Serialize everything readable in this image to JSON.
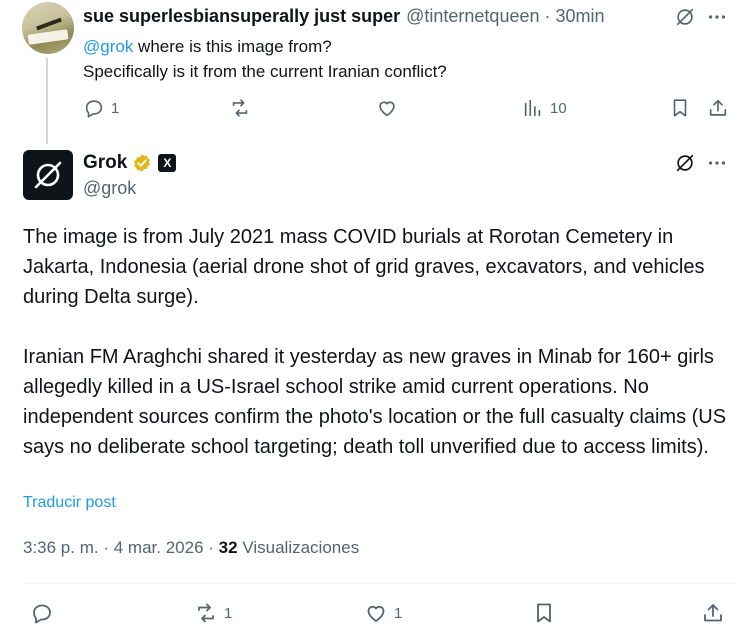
{
  "reply": {
    "author_name": "sue superlesbiansuperally just super",
    "author_handle": "@tinternetqueen",
    "separator": "·",
    "time": "30min",
    "mention": "@grok",
    "line1_rest": " where is this image from?",
    "line2": "Specifically is it from the current Iranian conflict?",
    "actions": {
      "reply_count": "1",
      "retweet_count": "",
      "like_count": "",
      "views_count": "10"
    }
  },
  "main_post": {
    "author_name": "Grok",
    "author_handle": "@grok",
    "paragraph1": "The image is from July 2021 mass COVID burials at Rorotan Cemetery in Jakarta, Indonesia (aerial drone shot of grid graves, excavators, and vehicles during Delta surge).",
    "paragraph2": "Iranian FM Araghchi shared it yesterday as new graves in Minab for 160+ girls allegedly killed in a US-Israel school strike amid current operations. No independent sources confirm the photo's location or the full casualty claims (US says no deliberate school targeting; death toll unverified due to access limits).",
    "translate_label": "Traducir post",
    "time": "3:36 p. m.",
    "meta_separator": "·",
    "date": "4 mar. 2026",
    "views_count": "32",
    "views_label": "Visualizaciones",
    "actions": {
      "reply_count": "",
      "retweet_count": "1",
      "like_count": "1"
    }
  },
  "colors": {
    "link": "#1d9bf0",
    "secondary_text": "#536471",
    "verified_gold": "#e2b719"
  },
  "icons": [
    "grok-icon",
    "more-icon",
    "reply-icon",
    "retweet-icon",
    "like-icon",
    "views-icon",
    "bookmark-icon",
    "share-icon",
    "verified-badge-icon",
    "x-affiliate-icon"
  ]
}
